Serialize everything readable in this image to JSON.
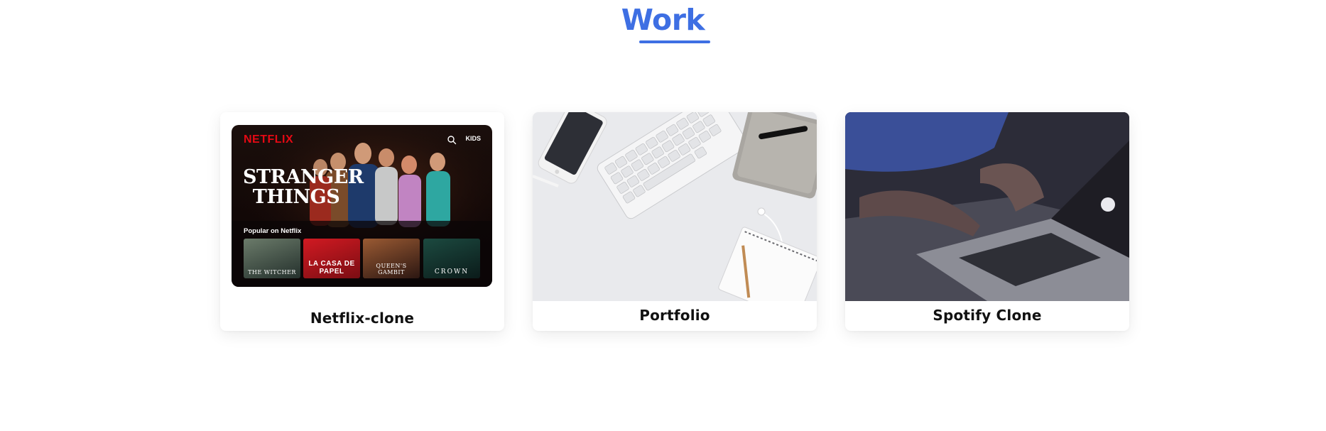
{
  "section": {
    "title": "Work",
    "accent": "#3e6fe3"
  },
  "cards": [
    {
      "label": "Netflix-clone",
      "image": {
        "brand": "NETFLIX",
        "kids": "KIDS",
        "title_line1": "STRANGER",
        "title_line2": "THINGS",
        "row_title": "Popular on Netflix",
        "thumbs": [
          "THE WITCHER",
          "LA CASA DE PAPEL",
          "QUEEN'S GAMBIT",
          "CROWN"
        ]
      }
    },
    {
      "label": "Portfolio"
    },
    {
      "label": "Spotify Clone"
    }
  ]
}
